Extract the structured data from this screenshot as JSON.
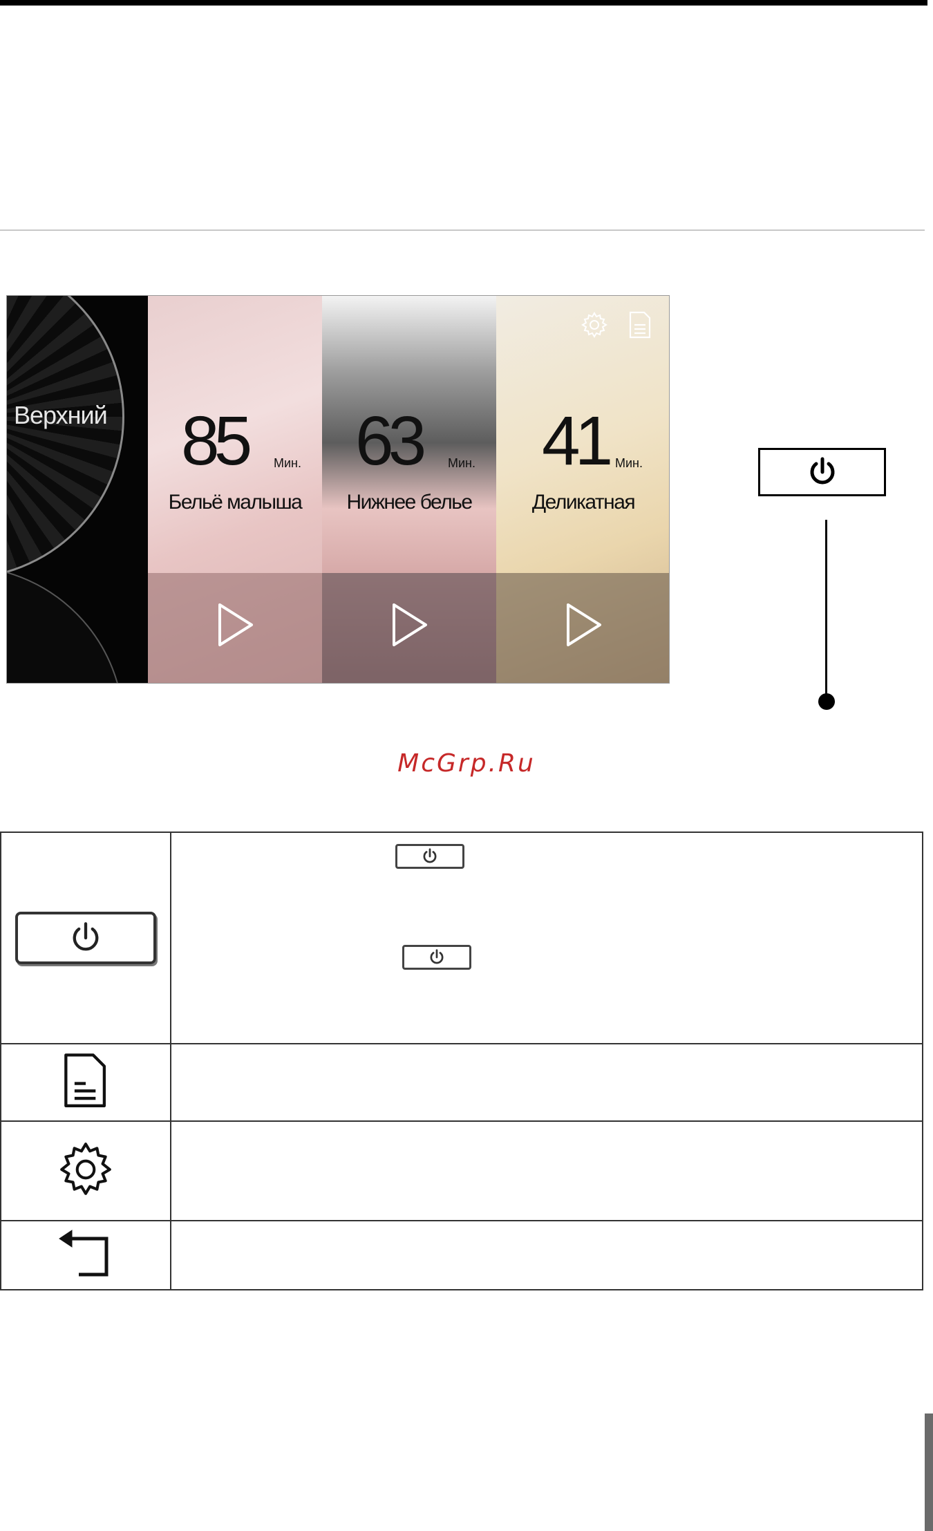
{
  "screen": {
    "dial_label": "Верхний",
    "programs": [
      {
        "minutes": "85",
        "unit": "Мин.",
        "name": "Бельё малыша"
      },
      {
        "minutes": "63",
        "unit": "Мин.",
        "name": "Нижнее белье"
      },
      {
        "minutes": "41",
        "unit": "Мин.",
        "name": "Деликатная"
      }
    ]
  },
  "watermark": "McGrp.Ru",
  "icons": {
    "power": "power-icon",
    "document": "document-icon",
    "settings": "gear-icon",
    "back": "back-arrow-icon",
    "play": "play-icon"
  },
  "colors": {
    "watermark": "#c62828",
    "border": "#333333"
  }
}
